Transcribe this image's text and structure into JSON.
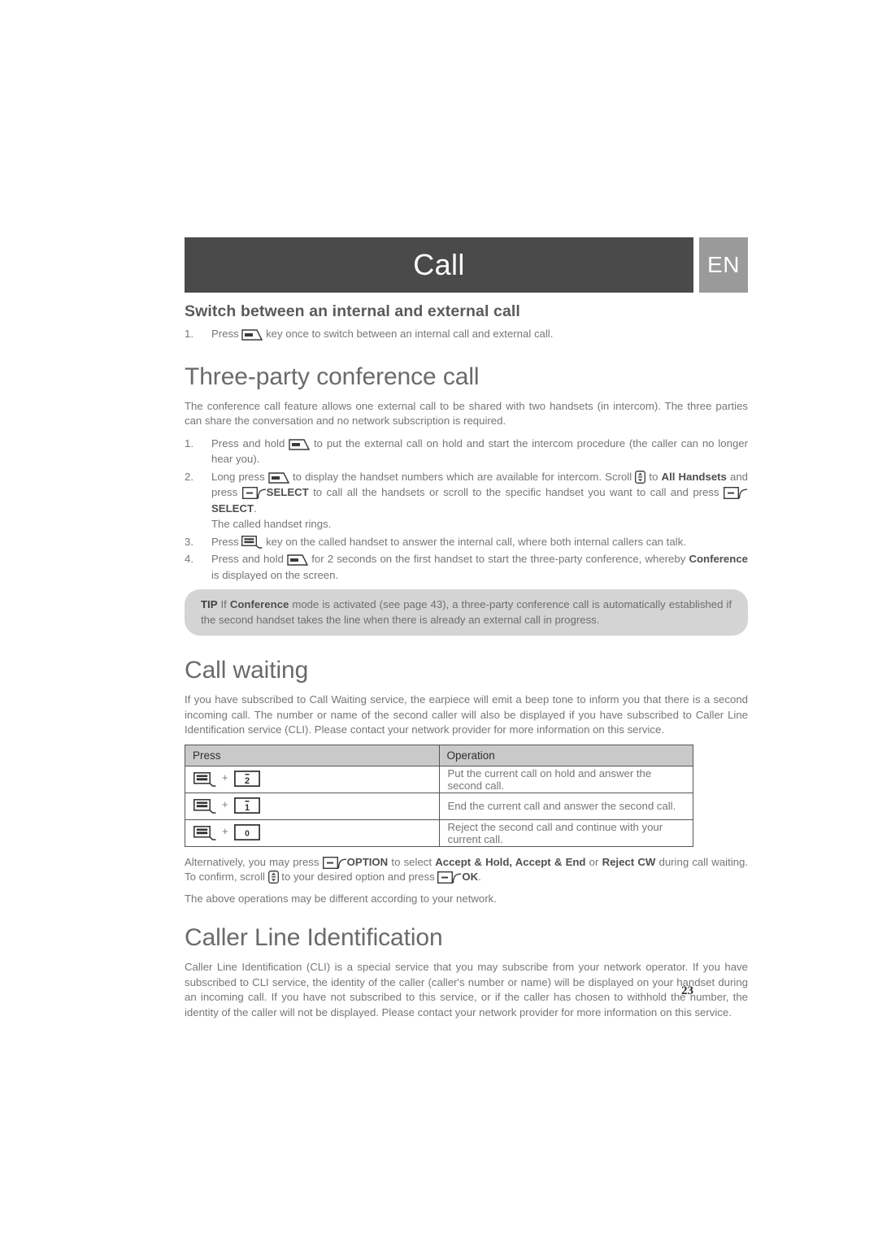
{
  "header": {
    "title": "Call",
    "language_badge": "EN",
    "bar_color": "#4a4a4a",
    "badge_color": "#9a9a9a"
  },
  "sections": {
    "switch_call": {
      "heading": "Switch between an internal and external call",
      "steps": [
        {
          "number": "1.",
          "before_icon": "Press",
          "icon": "int-key-icon",
          "after_icon": "key once to switch between an internal call and external call."
        }
      ]
    },
    "three_party": {
      "heading": "Three-party conference call",
      "intro": "The conference call feature allows one external call to be shared with two handsets (in intercom). The three parties can share the conversation and no network subscription is required.",
      "steps": [
        {
          "number": "1.",
          "parts": [
            {
              "t": "text",
              "v": "Press and hold "
            },
            {
              "t": "icon",
              "v": "int-key-icon"
            },
            {
              "t": "text",
              "v": " to put the external call on hold and start the intercom procedure (the caller can no longer hear you)."
            }
          ]
        },
        {
          "number": "2.",
          "parts": [
            {
              "t": "text",
              "v": "Long press "
            },
            {
              "t": "icon",
              "v": "int-key-icon"
            },
            {
              "t": "text",
              "v": " to display the handset numbers which are available for intercom. Scroll "
            },
            {
              "t": "icon",
              "v": "scroll-key-icon"
            },
            {
              "t": "text",
              "v": " to "
            },
            {
              "t": "bold",
              "v": "All Handsets"
            },
            {
              "t": "text",
              "v": " and press "
            },
            {
              "t": "icon",
              "v": "softkey-icon"
            },
            {
              "t": "bold",
              "v": " SELECT"
            },
            {
              "t": "text",
              "v": " to call all the handsets or scroll to the specific handset you want to call and press "
            },
            {
              "t": "icon",
              "v": "softkey-icon"
            },
            {
              "t": "bold",
              "v": " SELECT"
            },
            {
              "t": "text",
              "v": "."
            }
          ],
          "extra_line": "The called handset rings."
        },
        {
          "number": "3.",
          "parts": [
            {
              "t": "text",
              "v": "Press "
            },
            {
              "t": "icon",
              "v": "flash-talk-key-icon"
            },
            {
              "t": "text",
              "v": " key on the called handset to answer the internal call, where both internal callers can talk."
            }
          ]
        },
        {
          "number": "4.",
          "parts": [
            {
              "t": "text",
              "v": "Press and hold "
            },
            {
              "t": "icon",
              "v": "int-key-icon"
            },
            {
              "t": "text",
              "v": " for 2 seconds on the first handset to start the three-party conference, whereby "
            },
            {
              "t": "bold",
              "v": "Conference"
            },
            {
              "t": "text",
              "v": " is displayed on the screen."
            }
          ]
        }
      ],
      "tip": {
        "label": "TIP",
        "text_before_bold": " If ",
        "bold": "Conference",
        "text_after_bold": " mode is activated (see page 43), a three-party conference call is automatically established if the second handset takes the line when there is already an external call in progress."
      }
    },
    "call_waiting": {
      "heading": "Call waiting",
      "intro": "If you have subscribed to Call Waiting service, the earpiece will emit a beep tone to inform you that there is a second incoming call. The number or name of the second caller will also be displayed if you have subscribed to Caller Line Identification service (CLI). Please contact your network provider for more information on this service.",
      "table": {
        "columns": [
          "Press",
          "Operation"
        ],
        "rows": [
          {
            "keys": [
              "flash-talk-key-icon",
              "key-2-icon"
            ],
            "separator": "+",
            "operation": "Put the current call on hold and answer the second call."
          },
          {
            "keys": [
              "flash-talk-key-icon",
              "key-1-icon"
            ],
            "separator": "+",
            "operation": "End the current call and answer the second call."
          },
          {
            "keys": [
              "flash-talk-key-icon",
              "key-0-icon"
            ],
            "separator": "+",
            "operation": "Reject the second call and continue with your current call."
          }
        ]
      },
      "alt_paragraph": [
        {
          "t": "text",
          "v": "Alternatively, you may press "
        },
        {
          "t": "icon",
          "v": "softkey-icon"
        },
        {
          "t": "bold",
          "v": " OPTION"
        },
        {
          "t": "text",
          "v": " to select "
        },
        {
          "t": "bold",
          "v": "Accept & Hold, Accept & End"
        },
        {
          "t": "text",
          "v": " or "
        },
        {
          "t": "bold",
          "v": "Reject CW"
        },
        {
          "t": "text",
          "v": " during call waiting. To confirm, scroll "
        },
        {
          "t": "icon",
          "v": "scroll-key-icon"
        },
        {
          "t": "text",
          "v": " to your desired option and press "
        },
        {
          "t": "icon",
          "v": "softkey-icon"
        },
        {
          "t": "bold",
          "v": " OK"
        },
        {
          "t": "text",
          "v": "."
        }
      ],
      "note": "The above operations may be different according to your network."
    },
    "caller_line_id": {
      "heading": "Caller Line Identification",
      "body": "Caller Line Identification (CLI) is a special service that you may subscribe from your network operator. If you have subscribed to CLI service, the identity of the caller (caller's number or name) will be displayed on your handset during an incoming call. If you have not subscribed to this service, or if the caller has chosen to withhold the number, the identity of the caller will not be displayed. Please contact your network provider for more information on this service."
    }
  },
  "footer": {
    "page_number": "23"
  },
  "icon_labels": {
    "int-key-icon": "INT",
    "flash-talk-key-icon": "FLASH TALK",
    "key-2-icon": "2",
    "key-1-icon": "1",
    "key-0-icon": "0",
    "softkey-icon": "left soft key",
    "scroll-key-icon": "scroll up/down key"
  }
}
